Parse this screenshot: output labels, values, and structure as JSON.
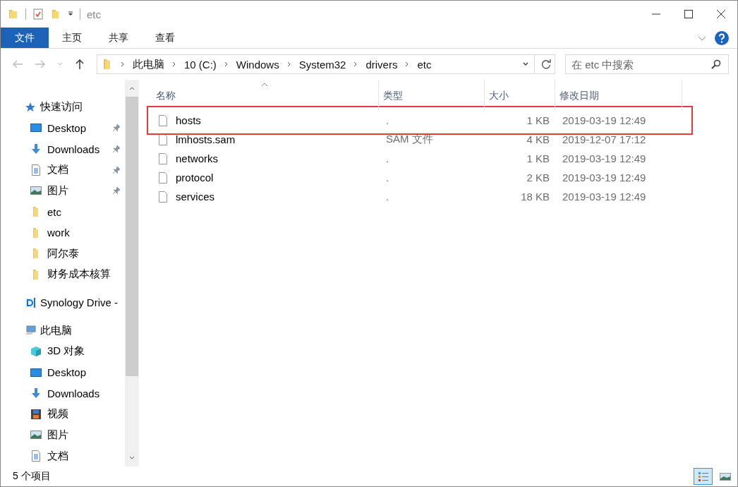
{
  "window": {
    "title": "etc"
  },
  "ribbon_tabs": [
    {
      "label": "文件",
      "selected": true
    },
    {
      "label": "主页",
      "selected": false
    },
    {
      "label": "共享",
      "selected": false
    },
    {
      "label": "查看",
      "selected": false
    }
  ],
  "breadcrumb": [
    "此电脑",
    "10 (C:)",
    "Windows",
    "System32",
    "drivers",
    "etc"
  ],
  "search": {
    "placeholder": "在 etc 中搜索"
  },
  "sidebar": {
    "sections": [
      {
        "label": "快速访问",
        "kind": "star",
        "children": [
          {
            "label": "Desktop",
            "kind": "desktop",
            "pinned": true
          },
          {
            "label": "Downloads",
            "kind": "download",
            "pinned": true
          },
          {
            "label": "文档",
            "kind": "document",
            "pinned": true
          },
          {
            "label": "图片",
            "kind": "picture",
            "pinned": true
          },
          {
            "label": "etc",
            "kind": "folder",
            "pinned": false
          },
          {
            "label": "work",
            "kind": "folder",
            "pinned": false
          },
          {
            "label": "阿尔泰",
            "kind": "folder",
            "pinned": false
          },
          {
            "label": "财务成本核算",
            "kind": "folder",
            "pinned": false
          }
        ]
      },
      {
        "label": "Synology Drive -",
        "kind": "drive"
      },
      {
        "label": "此电脑",
        "kind": "pc",
        "children": [
          {
            "label": "3D 对象",
            "kind": "cube",
            "pinned": false
          },
          {
            "label": "Desktop",
            "kind": "desktop",
            "pinned": false
          },
          {
            "label": "Downloads",
            "kind": "download",
            "pinned": false
          },
          {
            "label": "视频",
            "kind": "video",
            "pinned": false
          },
          {
            "label": "图片",
            "kind": "picture",
            "pinned": false
          },
          {
            "label": "文档",
            "kind": "document",
            "pinned": false
          }
        ]
      }
    ]
  },
  "table": {
    "columns": [
      "名称",
      "类型",
      "大小",
      "修改日期"
    ],
    "rows": [
      {
        "name": "hosts",
        "type": ".",
        "size": "1 KB",
        "modified": "2019-03-19 12:49",
        "highlighted": true
      },
      {
        "name": "lmhosts.sam",
        "type": "SAM 文件",
        "size": "4 KB",
        "modified": "2019-12-07 17:12",
        "highlighted": false
      },
      {
        "name": "networks",
        "type": ".",
        "size": "1 KB",
        "modified": "2019-03-19 12:49",
        "highlighted": false
      },
      {
        "name": "protocol",
        "type": ".",
        "size": "2 KB",
        "modified": "2019-03-19 12:49",
        "highlighted": false
      },
      {
        "name": "services",
        "type": ".",
        "size": "18 KB",
        "modified": "2019-03-19 12:49",
        "highlighted": false
      }
    ]
  },
  "status_bar": {
    "text": "5 个项目"
  },
  "view_buttons": [
    {
      "kind": "details",
      "selected": true
    },
    {
      "kind": "large-icons",
      "selected": false
    }
  ]
}
